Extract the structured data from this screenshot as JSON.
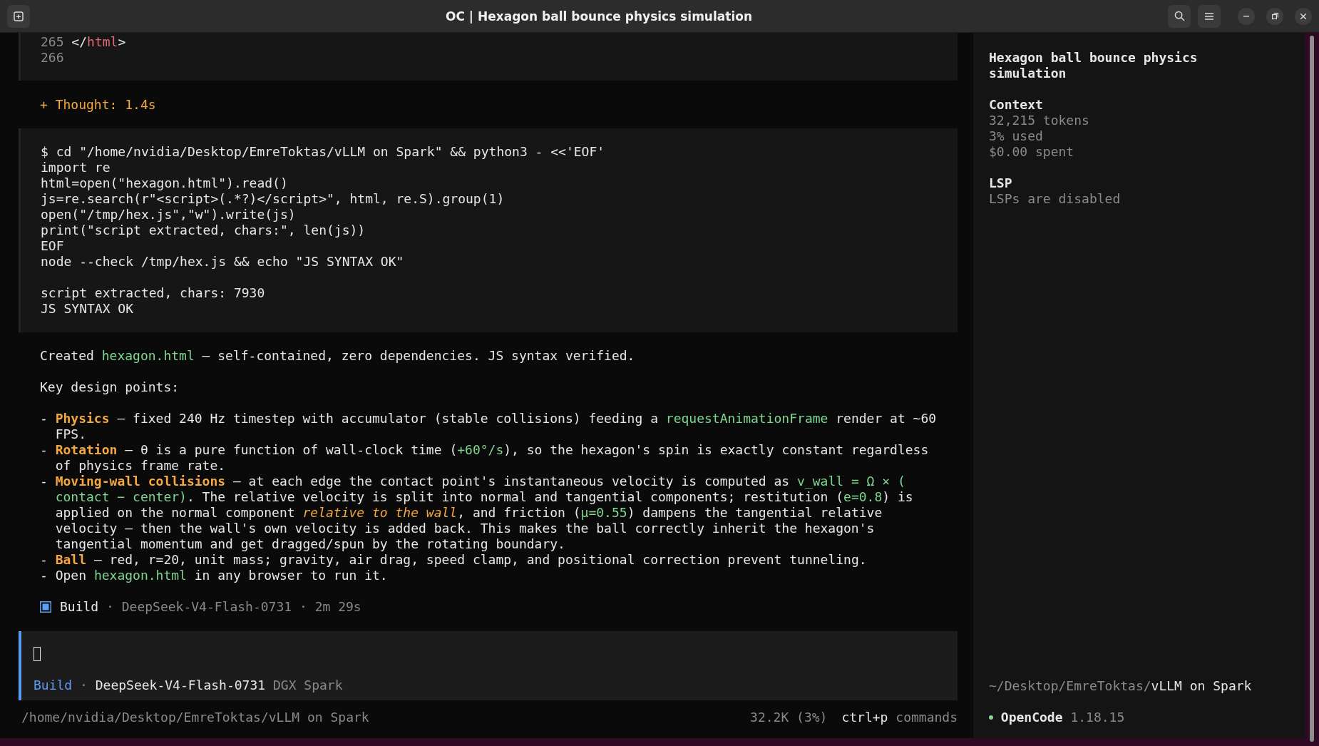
{
  "window": {
    "title": "OC | Hexagon ball bounce physics simulation"
  },
  "code_block": {
    "lines": [
      {
        "number": "265",
        "segments": [
          {
            "text": "</",
            "kind": "punct"
          },
          {
            "text": "html",
            "kind": "tag"
          },
          {
            "text": ">",
            "kind": "punct"
          }
        ]
      },
      {
        "number": "266"
      }
    ]
  },
  "thought": "+ Thought: 1.4s",
  "terminal": {
    "command": [
      "$ cd \"/home/nvidia/Desktop/EmreToktas/vLLM on Spark\" && python3 - <<'EOF'",
      "import re",
      "html=open(\"hexagon.html\").read()",
      "js=re.search(r\"<script>(.*?)</script>\", html, re.S).group(1)",
      "open(\"/tmp/hex.js\",\"w\").write(js)",
      "print(\"script extracted, chars:\", len(js))",
      "EOF",
      "node --check /tmp/hex.js && echo \"JS SYNTAX OK\""
    ],
    "output": [
      "script extracted, chars: 7930",
      "JS SYNTAX OK"
    ]
  },
  "intro": [
    {
      "text": "Created ",
      "kind": "plain"
    },
    {
      "text": "hexagon.html",
      "kind": "code"
    },
    {
      "text": " — self-contained, zero dependencies. JS syntax verified.",
      "kind": "plain"
    }
  ],
  "heading": "Key design points:",
  "bullets": [
    {
      "marker": "-",
      "segments": [
        {
          "text": "Physics",
          "kind": "strong"
        },
        {
          "text": " — fixed 240 Hz timestep with accumulator (stable collisions) feeding a ",
          "kind": "plain"
        },
        {
          "text": "requestAnimationFrame",
          "kind": "code"
        },
        {
          "text": " render at ~60 FPS.",
          "kind": "plain"
        }
      ]
    },
    {
      "marker": "-",
      "segments": [
        {
          "text": "Rotation",
          "kind": "strong"
        },
        {
          "text": " — θ is a pure function of wall-clock time (",
          "kind": "plain"
        },
        {
          "text": "+60°/s",
          "kind": "code"
        },
        {
          "text": "), so the hexagon's spin is exactly constant regardless of physics frame rate.",
          "kind": "plain"
        }
      ]
    },
    {
      "marker": "-",
      "segments": [
        {
          "text": "Moving-wall collisions",
          "kind": "strong"
        },
        {
          "text": " — at each edge the contact point's instantaneous velocity is computed as ",
          "kind": "plain"
        },
        {
          "text": "v_wall = Ω × ( contact − center)",
          "kind": "code"
        },
        {
          "text": ". The relative velocity is split into normal and tangential components; restitution (",
          "kind": "plain"
        },
        {
          "text": "e=0.8",
          "kind": "code"
        },
        {
          "text": ") is applied on the normal component ",
          "kind": "plain"
        },
        {
          "text": "relative to the wall",
          "kind": "emph"
        },
        {
          "text": ", and friction (",
          "kind": "plain"
        },
        {
          "text": "μ=0.55",
          "kind": "code"
        },
        {
          "text": ") dampens the tangential relative velocity — then the wall's own velocity is added back. This makes the ball correctly inherit the hexagon's tangential momentum and get dragged/spun by the rotating boundary.",
          "kind": "plain"
        }
      ]
    },
    {
      "marker": "-",
      "segments": [
        {
          "text": "Ball",
          "kind": "strong"
        },
        {
          "text": " — red, r=20, unit mass; gravity, air drag, speed clamp, and positional correction prevent tunneling.",
          "kind": "plain"
        }
      ]
    },
    {
      "marker": "-",
      "segments": [
        {
          "text": "Open ",
          "kind": "plain"
        },
        {
          "text": "hexagon.html",
          "kind": "code"
        },
        {
          "text": " in any browser to run it.",
          "kind": "plain"
        }
      ]
    }
  ],
  "status": {
    "agent": "Build",
    "details": "· DeepSeek-V4-Flash-0731 · 2m 29s"
  },
  "prompt": {
    "agent": "Build",
    "separator": "·",
    "model": "DeepSeek-V4-Flash-0731",
    "provider": "DGX Spark"
  },
  "footer": {
    "path": "/home/nvidia/Desktop/EmreToktas/vLLM on Spark",
    "usage": "32.2K (3%)",
    "shortcut": "ctrl+p",
    "shortcut_label": "commands"
  },
  "sidebar": {
    "title": "Hexagon ball bounce physics simulation",
    "sections": [
      {
        "heading": "Context",
        "lines": [
          "32,215 tokens",
          "3% used",
          "$0.00 spent"
        ]
      },
      {
        "heading": "LSP",
        "lines": [
          "LSPs are disabled"
        ]
      }
    ],
    "path_prefix": "~/Desktop/EmreToktas/",
    "path_name": "vLLM on Spark",
    "app_name": "OpenCode",
    "version": "1.18.15"
  }
}
